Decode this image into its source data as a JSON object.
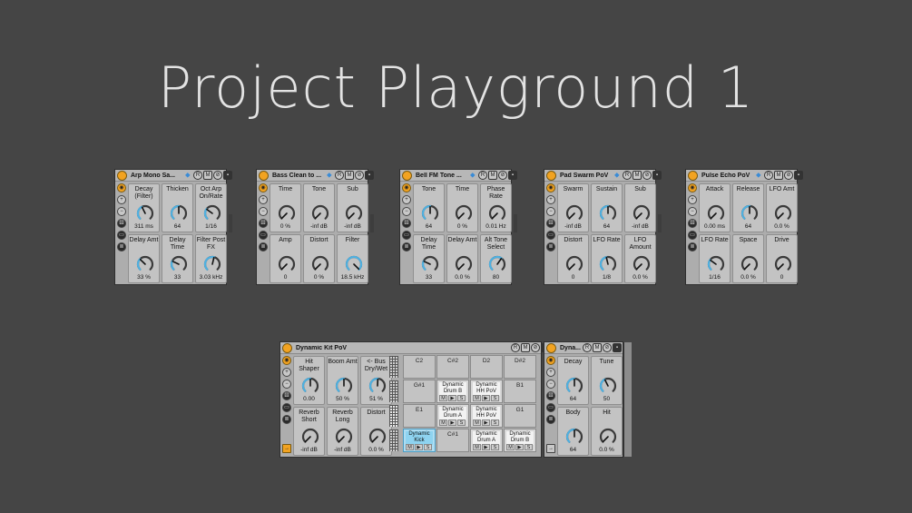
{
  "title": "Project Playground 1",
  "colors": {
    "accent": "#f2a321",
    "knob_arc": "#4fb0e0",
    "panel": "#adadad"
  },
  "racks": [
    {
      "name": "Arp Mono Sa...",
      "macros": [
        {
          "label": "Decay (Filter)",
          "value": "311 ms",
          "level": 0.4
        },
        {
          "label": "Thicken",
          "value": "64",
          "level": 0.5
        },
        {
          "label": "Oct Arp On/Rate",
          "value": "1/16",
          "level": 0.3
        },
        {
          "label": "Delay Amt",
          "value": "33 %",
          "level": 0.33
        },
        {
          "label": "Delay Time",
          "value": "33",
          "level": 0.26
        },
        {
          "label": "Filter Post FX",
          "value": "3.03 kHz",
          "level": 0.55
        }
      ]
    },
    {
      "name": "Bass Clean to ...",
      "macros": [
        {
          "label": "Time",
          "value": "0 %",
          "level": 0
        },
        {
          "label": "Tone",
          "value": "-inf dB",
          "level": 0
        },
        {
          "label": "Sub",
          "value": "-inf dB",
          "level": 0
        },
        {
          "label": "Amp",
          "value": "0",
          "level": 0
        },
        {
          "label": "Distort",
          "value": "0 %",
          "level": 0
        },
        {
          "label": "Filter",
          "value": "18.5 kHz",
          "level": 1
        }
      ]
    },
    {
      "name": "Bell FM Tone ...",
      "macros": [
        {
          "label": "Tone",
          "value": "64",
          "level": 0.5
        },
        {
          "label": "Time",
          "value": "0 %",
          "level": 0
        },
        {
          "label": "Phase Rate",
          "value": "0.01 Hz",
          "level": 0
        },
        {
          "label": "Delay Time",
          "value": "33",
          "level": 0.26
        },
        {
          "label": "Delay Amt",
          "value": "0.0 %",
          "level": 0
        },
        {
          "label": "Alt Tone Select",
          "value": "80",
          "level": 0.63
        }
      ]
    },
    {
      "name": "Pad Swarm PoV",
      "macros": [
        {
          "label": "Swarm",
          "value": "-inf dB",
          "level": 0
        },
        {
          "label": "Sustain",
          "value": "64",
          "level": 0.5
        },
        {
          "label": "Sub",
          "value": "-inf dB",
          "level": 0
        },
        {
          "label": "Distort",
          "value": "0",
          "level": 0
        },
        {
          "label": "LFO Rate",
          "value": "1/8",
          "level": 0.45
        },
        {
          "label": "LFO Amount",
          "value": "0.0 %",
          "level": 0
        }
      ]
    },
    {
      "name": "Pulse Echo PoV",
      "macros": [
        {
          "label": "Attack",
          "value": "0.00 ms",
          "level": 0
        },
        {
          "label": "Release",
          "value": "64",
          "level": 0.5
        },
        {
          "label": "LFO Amt",
          "value": "0.0 %",
          "level": 0
        },
        {
          "label": "LFO Rate",
          "value": "1/16",
          "level": 0.3
        },
        {
          "label": "Space",
          "value": "0.0 %",
          "level": 0
        },
        {
          "label": "Drive",
          "value": "0",
          "level": 0
        }
      ]
    }
  ],
  "kit": {
    "name": "Dynamic Kit PoV",
    "macros": [
      {
        "label": "Hit Shaper",
        "value": "0.00",
        "level": 0.5
      },
      {
        "label": "Boom Amt",
        "value": "50 %",
        "level": 0.5
      },
      {
        "label": "<- Bus Dry/Wet",
        "value": "51 %",
        "level": 0.51
      },
      {
        "label": "Reverb Short",
        "value": "-inf dB",
        "level": 0
      },
      {
        "label": "Reverb Long",
        "value": "-inf dB",
        "level": 0
      },
      {
        "label": "Distort",
        "value": "0.0 %",
        "level": 0
      }
    ],
    "pads": [
      {
        "note": "C2",
        "name": ""
      },
      {
        "note": "C#2",
        "name": ""
      },
      {
        "note": "D2",
        "name": ""
      },
      {
        "note": "D#2",
        "name": ""
      },
      {
        "note": "G#1",
        "name": ""
      },
      {
        "note": "",
        "name": "Dynamic Drum B"
      },
      {
        "note": "",
        "name": "Dynamic HH PoV"
      },
      {
        "note": "B1",
        "name": ""
      },
      {
        "note": "E1",
        "name": ""
      },
      {
        "note": "",
        "name": "Dynamic Drum A"
      },
      {
        "note": "",
        "name": "Dynamic HH PoV"
      },
      {
        "note": "G1",
        "name": ""
      },
      {
        "note": "",
        "name": "Dynamic Kick",
        "selected": true
      },
      {
        "note": "C#1",
        "name": ""
      },
      {
        "note": "",
        "name": "Dynamic Drum A"
      },
      {
        "note": "",
        "name": "Dynamic Drum B"
      }
    ],
    "pad_controls": [
      "M",
      "▶",
      "S"
    ]
  },
  "drum": {
    "name": "Dyna...",
    "macros": [
      {
        "label": "Decay",
        "value": "64",
        "level": 0.5
      },
      {
        "label": "Tune",
        "value": "50",
        "level": 0.4
      },
      {
        "label": "Body",
        "value": "64",
        "level": 0.5
      },
      {
        "label": "Hit",
        "value": "0.0 %",
        "level": 0
      }
    ]
  },
  "header_buttons": {
    "r": "R",
    "m": "M"
  }
}
